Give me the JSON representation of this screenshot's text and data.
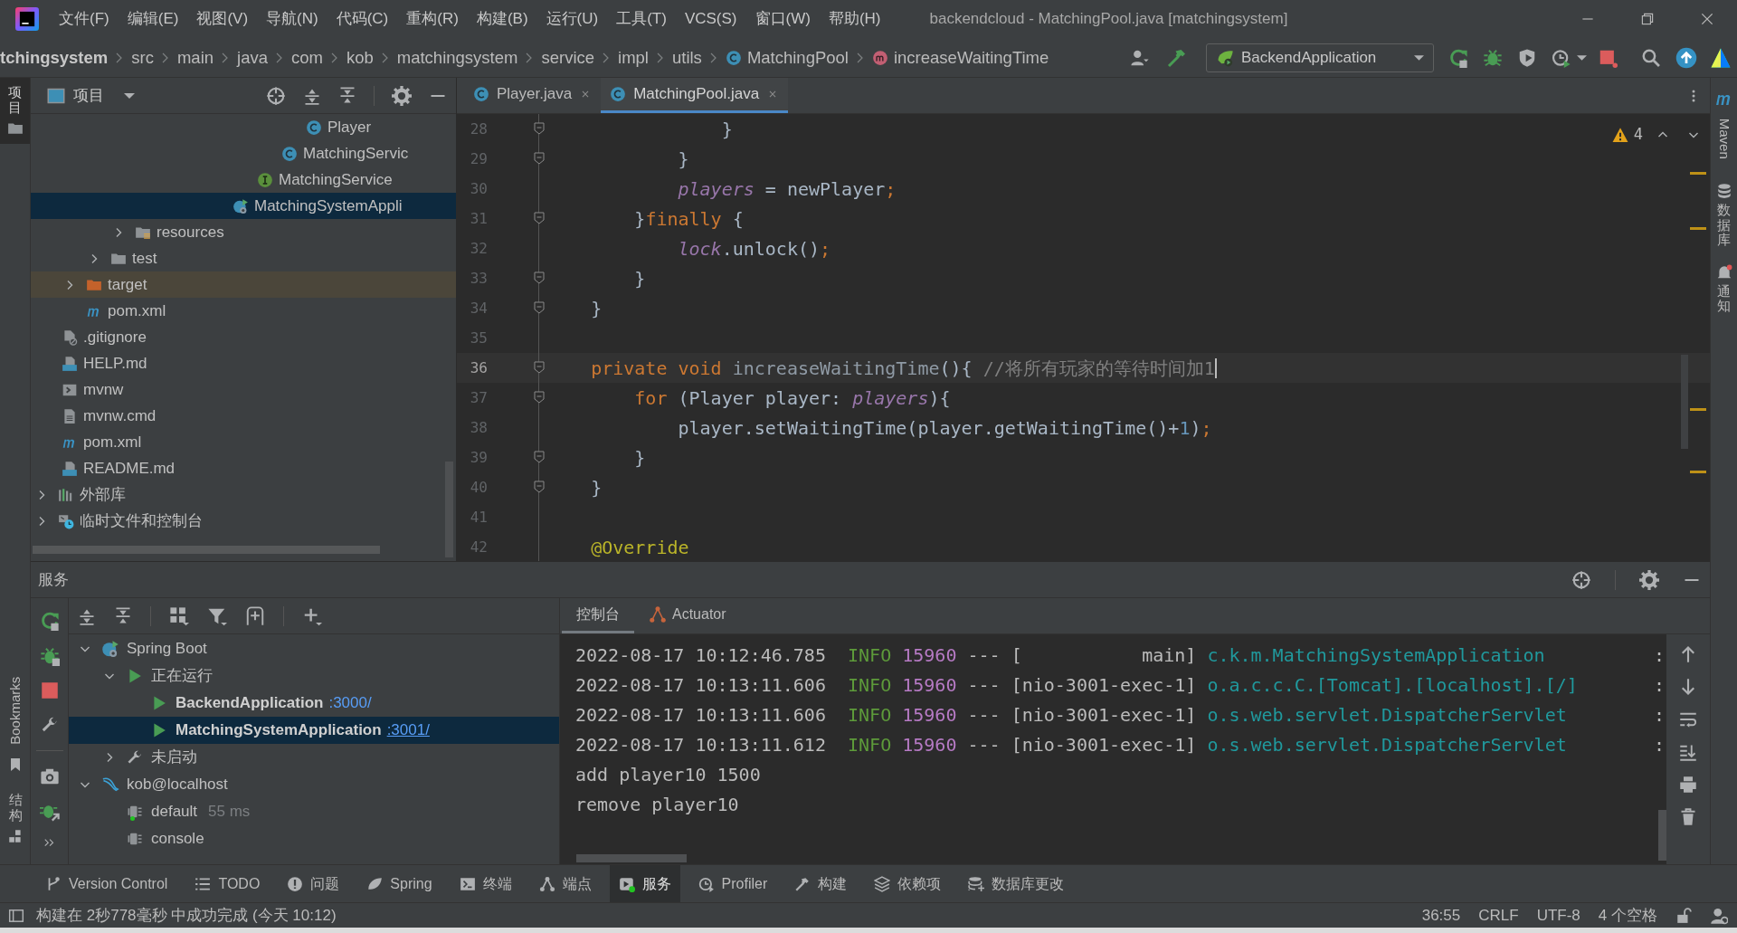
{
  "window": {
    "title": "backendcloud - MatchingPool.java [matchingsystem]"
  },
  "menu": [
    "文件(F)",
    "编辑(E)",
    "视图(V)",
    "导航(N)",
    "代码(C)",
    "重构(R)",
    "构建(B)",
    "运行(U)",
    "工具(T)",
    "VCS(S)",
    "窗口(W)",
    "帮助(H)"
  ],
  "breadcrumb": [
    {
      "label": "tchingsystem",
      "kind": "module"
    },
    {
      "label": "src",
      "kind": "dir"
    },
    {
      "label": "main",
      "kind": "dir"
    },
    {
      "label": "java",
      "kind": "dir"
    },
    {
      "label": "com",
      "kind": "dir"
    },
    {
      "label": "kob",
      "kind": "dir"
    },
    {
      "label": "matchingsystem",
      "kind": "dir"
    },
    {
      "label": "service",
      "kind": "dir"
    },
    {
      "label": "impl",
      "kind": "dir"
    },
    {
      "label": "utils",
      "kind": "dir"
    },
    {
      "label": "MatchingPool",
      "kind": "class"
    },
    {
      "label": "increaseWaitingTime",
      "kind": "method"
    }
  ],
  "run_config": {
    "label": "BackendApplication"
  },
  "left_strip": {
    "project": "项目",
    "bookmarks": "Bookmarks",
    "structure": "结构"
  },
  "project_panel": {
    "title": "项目",
    "tree": [
      {
        "children": [
          {
            "children": [
              {
                "children": [
                  {
                    "children": [
                      {
                        "children": [
                          {
                            "children": [
                              {
                                "children": [
                                  {
                                    "children": [
                                      {
                                        "children": [
                                          {
                                            "children": [
                                              {
                                                "children": [
                                                  {
                                                    "label": "Player",
                                                    "kind": "class",
                                                    "selected": false
                                                  }
                                                ]
                                              },
                                              {
                                                "label": "MatchingServic",
                                                "kind": "class",
                                                "selected": false
                                              }
                                            ]
                                          },
                                          {
                                            "label": "MatchingService",
                                            "kind": "interface",
                                            "selected": false
                                          }
                                        ]
                                      },
                                      {
                                        "label": "MatchingSystemAppli",
                                        "kind": "springboot",
                                        "selected": true
                                      }
                                    ]
                                  }
                                ]
                              }
                            ]
                          }
                        ]
                      },
                      {
                        "label": "resources",
                        "kind": "resources-folder",
                        "expanded": false,
                        "selected": false
                      }
                    ]
                  },
                  {
                    "label": "test",
                    "kind": "folder",
                    "expanded": false,
                    "selected": false
                  }
                ]
              },
              {
                "label": "target",
                "kind": "excluded-folder",
                "expanded": false,
                "selected": false
              },
              {
                "label": "pom.xml",
                "kind": "maven",
                "selected": false
              }
            ]
          },
          {
            "label": ".gitignore",
            "kind": "ignore-file",
            "selected": false
          },
          {
            "label": "HELP.md",
            "kind": "markdown",
            "selected": false
          },
          {
            "label": "mvnw",
            "kind": "shell",
            "selected": false
          },
          {
            "label": "mvnw.cmd",
            "kind": "text-file",
            "selected": false
          },
          {
            "label": "pom.xml",
            "kind": "maven",
            "selected": false
          },
          {
            "label": "README.md",
            "kind": "markdown",
            "selected": false
          }
        ]
      },
      {
        "label": "外部库",
        "kind": "library",
        "expanded": false,
        "selected": false
      },
      {
        "label": "临时文件和控制台",
        "kind": "scratch",
        "expanded": false,
        "selected": false
      }
    ]
  },
  "editor": {
    "tabs": [
      {
        "label": "Player.java",
        "selected": false
      },
      {
        "label": "MatchingPool.java",
        "selected": true
      }
    ],
    "warnings": "4",
    "lines": [
      {
        "number": "28",
        "fold": true,
        "current": false,
        "tokens": [
          {
            "kind": "plain",
            "text": "                }"
          }
        ]
      },
      {
        "number": "29",
        "fold": true,
        "current": false,
        "tokens": [
          {
            "kind": "plain",
            "text": "            }"
          }
        ]
      },
      {
        "number": "30",
        "fold": false,
        "current": false,
        "tokens": [
          {
            "kind": "field",
            "text": "            players"
          },
          {
            "kind": "plain",
            "text": " = newPlayer"
          },
          {
            "kind": "keyword",
            "text": ";"
          }
        ]
      },
      {
        "number": "31",
        "fold": true,
        "current": false,
        "tokens": [
          {
            "kind": "plain",
            "text": "        }"
          },
          {
            "kind": "keyword",
            "text": "finally"
          },
          {
            "kind": "plain",
            "text": " {"
          }
        ]
      },
      {
        "number": "32",
        "fold": false,
        "current": false,
        "tokens": [
          {
            "kind": "field",
            "text": "            lock"
          },
          {
            "kind": "plain",
            "text": ".unlock()"
          },
          {
            "kind": "keyword",
            "text": ";"
          }
        ]
      },
      {
        "number": "33",
        "fold": true,
        "current": false,
        "tokens": [
          {
            "kind": "plain",
            "text": "        }"
          }
        ]
      },
      {
        "number": "34",
        "fold": true,
        "current": false,
        "tokens": [
          {
            "kind": "plain",
            "text": "    }"
          }
        ]
      },
      {
        "number": "35",
        "fold": false,
        "current": false
      },
      {
        "number": "36",
        "fold": true,
        "current": true,
        "tokens": [
          {
            "kind": "keyword",
            "text": "    private void "
          },
          {
            "kind": "unused",
            "text": "increaseWaitingTime"
          },
          {
            "kind": "plain",
            "text": "(){ "
          },
          {
            "kind": "comment",
            "text": "//将所有玩家的等待时间加1"
          }
        ]
      },
      {
        "number": "37",
        "fold": true,
        "current": false,
        "tokens": [
          {
            "kind": "keyword",
            "text": "        for "
          },
          {
            "kind": "plain",
            "text": "(Player player: "
          },
          {
            "kind": "field",
            "text": "players"
          },
          {
            "kind": "plain",
            "text": "){"
          }
        ]
      },
      {
        "number": "38",
        "fold": false,
        "current": false,
        "tokens": [
          {
            "kind": "plain",
            "text": "            player.setWaitingTime(player.getWaitingTime()+"
          },
          {
            "kind": "number",
            "text": "1"
          },
          {
            "kind": "plain",
            "text": ")"
          },
          {
            "kind": "keyword",
            "text": ";"
          }
        ]
      },
      {
        "number": "39",
        "fold": true,
        "current": false,
        "tokens": [
          {
            "kind": "plain",
            "text": "        }"
          }
        ]
      },
      {
        "number": "40",
        "fold": true,
        "current": false,
        "tokens": [
          {
            "kind": "plain",
            "text": "    }"
          }
        ]
      },
      {
        "number": "41",
        "fold": false,
        "current": false
      },
      {
        "number": "42",
        "fold": false,
        "current": false,
        "tokens": [
          {
            "kind": "annotation",
            "text": "    @Override"
          }
        ]
      }
    ]
  },
  "right_strip": {
    "maven": "Maven",
    "database": "数据库",
    "notifications": "通知"
  },
  "services": {
    "title": "服务",
    "tree": [
      {
        "label": "Spring Boot",
        "kind": "springboot",
        "expanded": true,
        "selected": false,
        "children": [
          {
            "label": "正在运行",
            "kind": "running",
            "expanded": true,
            "selected": false,
            "children": [
              {
                "label": "BackendApplication",
                "port": ":3000/",
                "kind": "app",
                "selected": false
              },
              {
                "label": "MatchingSystemApplication",
                "port": ":3001/",
                "kind": "app",
                "selected": true
              }
            ]
          },
          {
            "label": "未启动",
            "kind": "not-started",
            "expanded": false,
            "selected": false
          }
        ]
      },
      {
        "label": "kob@localhost",
        "kind": "database",
        "expanded": true,
        "selected": false,
        "children": [
          {
            "label": "default",
            "detail": "55 ms",
            "kind": "session-connected",
            "selected": false
          },
          {
            "label": "console",
            "kind": "session",
            "selected": false
          }
        ]
      }
    ],
    "console_tabs": [
      {
        "label": "控制台",
        "selected": true
      },
      {
        "label": "Actuator",
        "selected": false
      }
    ],
    "console": [
      {
        "kind": "log",
        "date": "2022-08-17 10:12:46.785",
        "level": "INFO",
        "pid": "15960",
        "separator": "---",
        "thread": "[           main]",
        "logger": "c.k.m.MatchingSystemApplication",
        "colon": ":"
      },
      {
        "kind": "log",
        "date": "2022-08-17 10:13:11.606",
        "level": "INFO",
        "pid": "15960",
        "separator": "---",
        "thread": "[nio-3001-exec-1]",
        "logger": "o.a.c.c.C.[Tomcat].[localhost].[/]",
        "colon": ":"
      },
      {
        "kind": "log",
        "date": "2022-08-17 10:13:11.606",
        "level": "INFO",
        "pid": "15960",
        "separator": "---",
        "thread": "[nio-3001-exec-1]",
        "logger": "o.s.web.servlet.DispatcherServlet",
        "colon": ":"
      },
      {
        "kind": "log",
        "date": "2022-08-17 10:13:11.612",
        "level": "INFO",
        "pid": "15960",
        "separator": "---",
        "thread": "[nio-3001-exec-1]",
        "logger": "o.s.web.servlet.DispatcherServlet",
        "colon": ":"
      },
      {
        "kind": "plain",
        "text": "add player10 1500"
      },
      {
        "kind": "plain",
        "text": "remove player10"
      }
    ]
  },
  "tool_tabs": [
    {
      "label": "Version Control",
      "selected": false
    },
    {
      "label": "TODO",
      "selected": false
    },
    {
      "label": "问题",
      "selected": false
    },
    {
      "label": "Spring",
      "selected": false
    },
    {
      "label": "终端",
      "selected": false
    },
    {
      "label": "端点",
      "selected": false
    },
    {
      "label": "服务",
      "selected": true
    },
    {
      "label": "Profiler",
      "selected": false
    },
    {
      "label": "构建",
      "selected": false
    },
    {
      "label": "依赖项",
      "selected": false
    },
    {
      "label": "数据库更改",
      "selected": false
    }
  ],
  "status_bar": {
    "message": "构建在 2秒778毫秒 中成功完成 (今天 10:12)",
    "position": "36:55",
    "line_separator": "CRLF",
    "encoding": "UTF-8",
    "indent": "4 个空格"
  }
}
